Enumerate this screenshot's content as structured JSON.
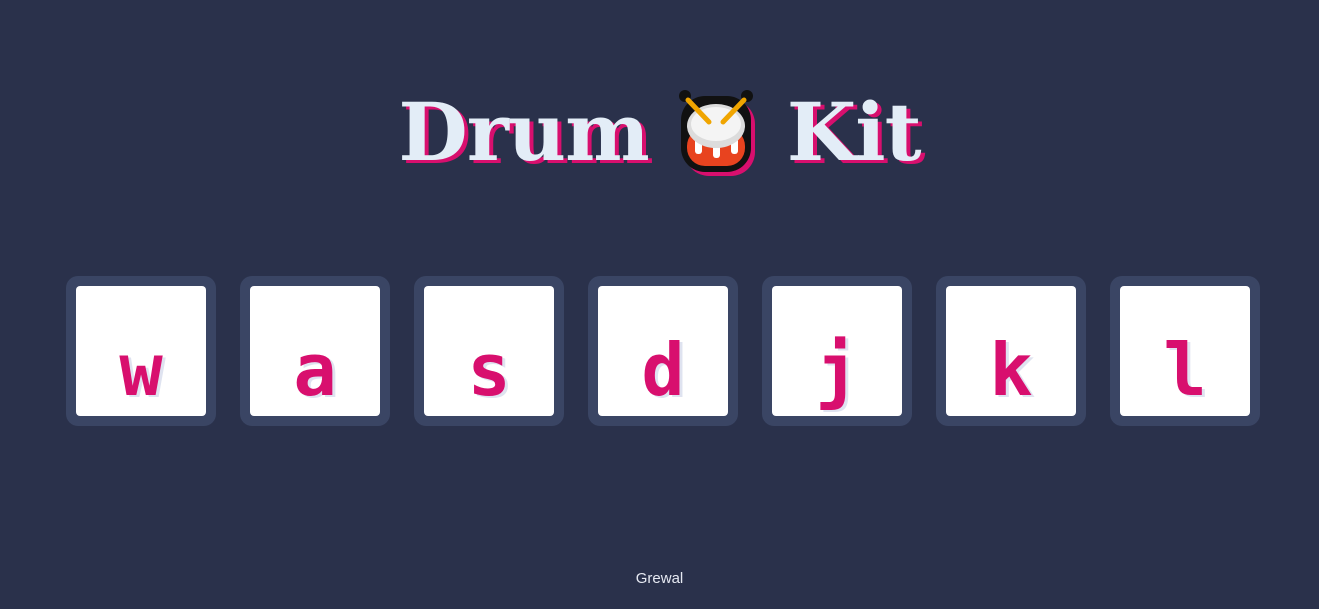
{
  "header": {
    "title_word_1": "Drum",
    "title_word_2": "Kit",
    "icon": "drum-icon"
  },
  "keys": [
    {
      "label": "w"
    },
    {
      "label": "a"
    },
    {
      "label": "s"
    },
    {
      "label": "d"
    },
    {
      "label": "j"
    },
    {
      "label": "k"
    },
    {
      "label": "l"
    }
  ],
  "footer": {
    "text": "Grewal"
  },
  "colors": {
    "background": "#2a314b",
    "accent": "#d80f6e",
    "title": "#e3edf7",
    "key_frame": "#3a4564",
    "key_face": "#ffffff"
  }
}
